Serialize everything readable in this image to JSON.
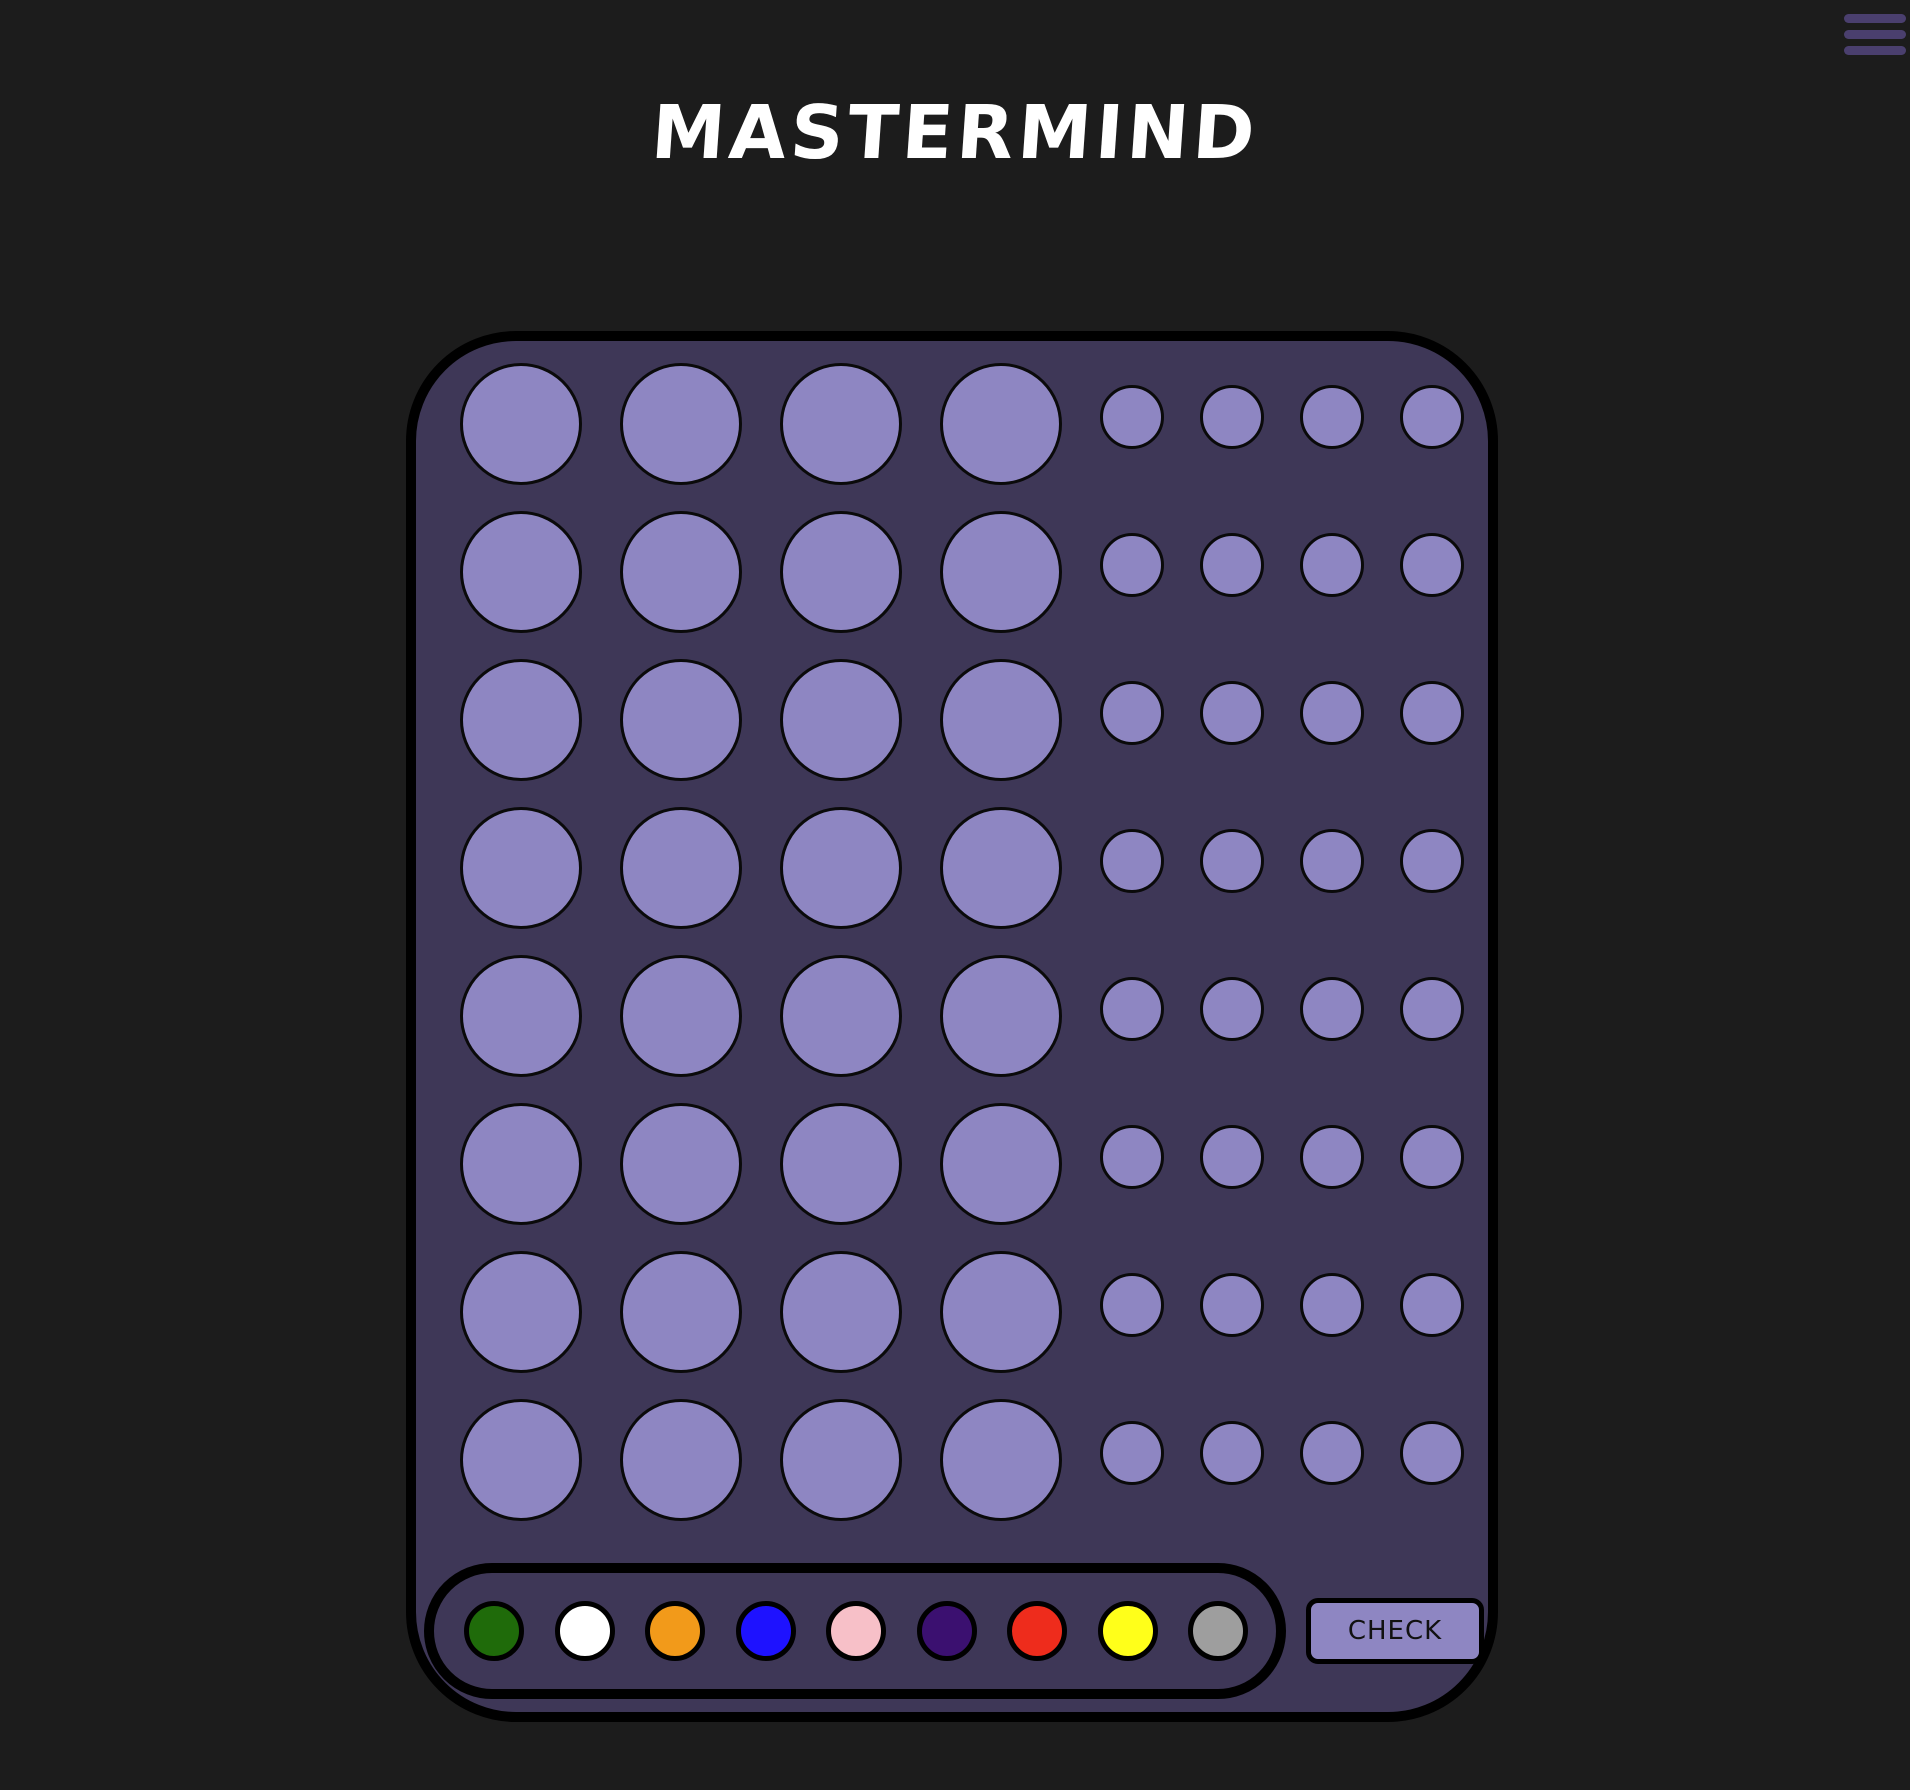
{
  "title": "MASTERMIND",
  "menu": {
    "icon": "hamburger-menu-icon",
    "color": "#4a3f6e"
  },
  "board": {
    "background": "#3e3757",
    "peg_color": "#8e86c2",
    "rows": 8,
    "pegs_per_row": 4,
    "hints_per_row": 4
  },
  "palette": {
    "colors": [
      {
        "name": "green",
        "hex": "#1f6b0a"
      },
      {
        "name": "white",
        "hex": "#ffffff"
      },
      {
        "name": "orange",
        "hex": "#f29a1a"
      },
      {
        "name": "blue",
        "hex": "#1e12ff"
      },
      {
        "name": "pink",
        "hex": "#f7c0c8"
      },
      {
        "name": "purple",
        "hex": "#3b1070"
      },
      {
        "name": "red",
        "hex": "#ee2c1c"
      },
      {
        "name": "yellow",
        "hex": "#ffff1a"
      },
      {
        "name": "gray",
        "hex": "#9e9e9e"
      }
    ]
  },
  "check_button": {
    "label": "CHECK"
  }
}
